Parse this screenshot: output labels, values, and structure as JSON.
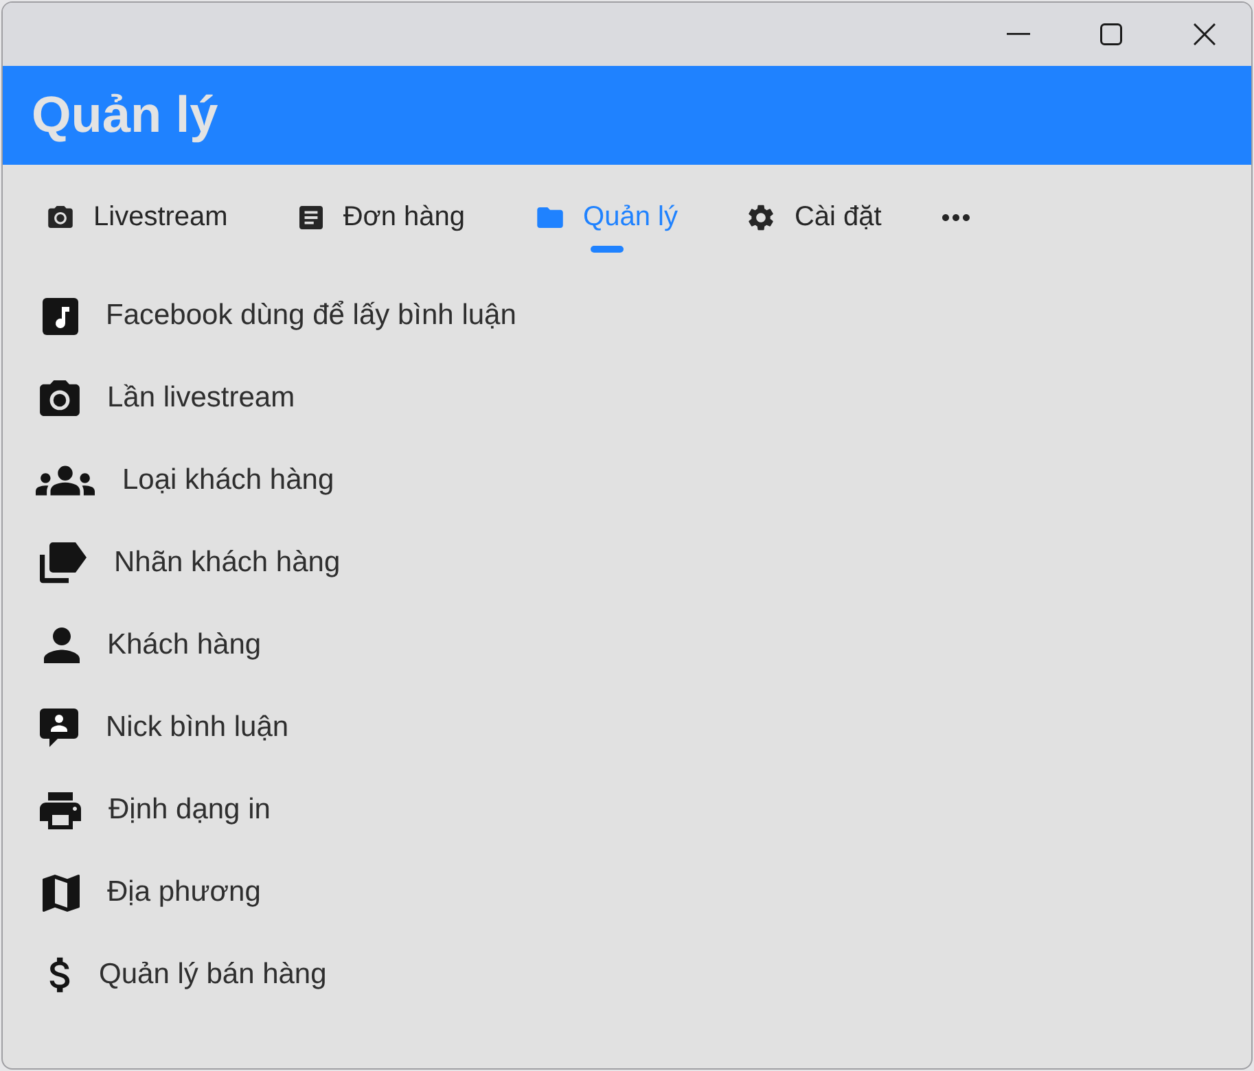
{
  "header": {
    "title": "Quản lý"
  },
  "tabs": [
    {
      "label": "Livestream",
      "selected": false
    },
    {
      "label": "Đơn hàng",
      "selected": false
    },
    {
      "label": "Quản lý",
      "selected": true
    },
    {
      "label": "Cài đặt",
      "selected": false
    }
  ],
  "menu": {
    "items": [
      {
        "label": "Facebook dùng để lấy bình luận"
      },
      {
        "label": "Lần livestream"
      },
      {
        "label": "Loại khách hàng"
      },
      {
        "label": "Nhãn khách hàng"
      },
      {
        "label": "Khách hàng"
      },
      {
        "label": "Nick bình luận"
      },
      {
        "label": "Định dạng in"
      },
      {
        "label": "Địa phương"
      },
      {
        "label": "Quản lý bán hàng"
      }
    ]
  }
}
